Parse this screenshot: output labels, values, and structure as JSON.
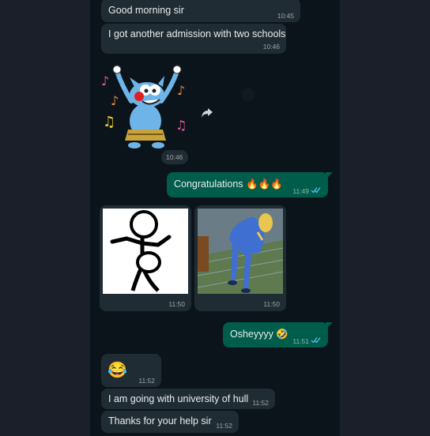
{
  "messages": [
    {
      "text": "Good morning sir",
      "time": "10:45"
    },
    {
      "text": "I got another admission with two schools",
      "time": "10:46"
    },
    {
      "sticker": "dancing-cat-sticker",
      "time": "10:46"
    },
    {
      "text": "Congratulations 🔥🔥🔥",
      "time": "11:49"
    },
    {
      "image": "stick-figure-image",
      "time": "11:50"
    },
    {
      "image": "cartoon-bending-image",
      "time": "11:50"
    },
    {
      "text": "Oshеyyyy 🤣",
      "time": "11:51"
    },
    {
      "text": "😂",
      "time": "11:52"
    },
    {
      "text": "I am going with university of hull",
      "time": "11:52"
    },
    {
      "text": "Thanks for your help sir",
      "time": "11:52"
    }
  ],
  "colors": {
    "incoming": "#202c33",
    "outgoing": "#005c4b",
    "read_ticks": "#53bdeb",
    "background": "#0b141a"
  }
}
